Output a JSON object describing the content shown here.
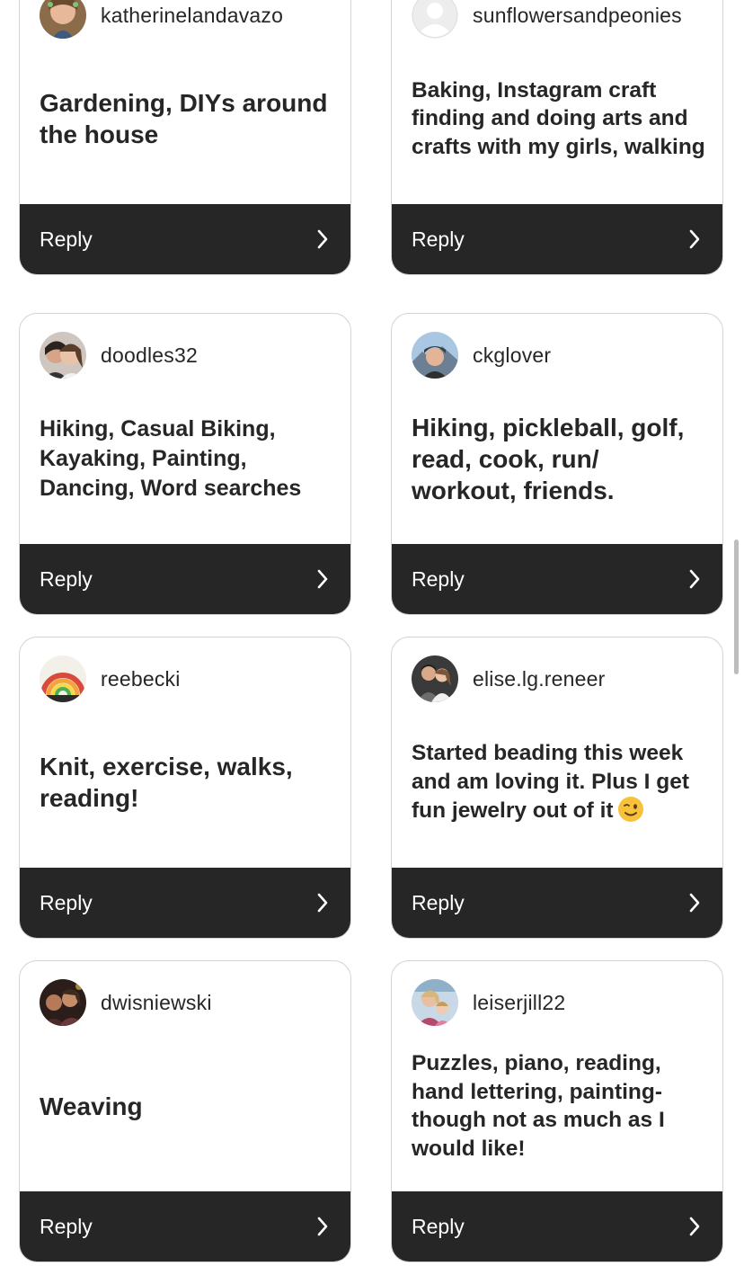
{
  "cards": [
    {
      "username": "katherinelandavazo",
      "text": "Gardening, DIYs around the house",
      "reply": "Reply",
      "avatar": "woman-smiling-avatar"
    },
    {
      "username": "sunflowersandpeonies",
      "text": "Baking, Instagram craft finding and doing arts and crafts with my girls, walking",
      "reply": "Reply",
      "avatar": "default-user-avatar"
    },
    {
      "username": "doodles32",
      "text": "Hiking, Casual Biking, Kayaking, Painting, Dancing, Word searches",
      "reply": "Reply",
      "avatar": "couple-avatar"
    },
    {
      "username": "ckglover",
      "text": "Hiking, pickleball, golf, read, cook, run/ workout, friends.",
      "reply": "Reply",
      "avatar": "woman-mountains-avatar"
    },
    {
      "username": "reebecki",
      "text": "Knit, exercise, walks, reading!",
      "reply": "Reply",
      "avatar": "knit-rainbow-avatar"
    },
    {
      "username": "elise.lg.reneer",
      "text": "Started beading this week and am loving it. Plus I get fun jewelry out of it",
      "reply": "Reply",
      "avatar": "couple-dark-avatar"
    },
    {
      "username": "dwisniewski",
      "text": "Weaving",
      "reply": "Reply",
      "avatar": "group-night-avatar"
    },
    {
      "username": "leiserjill22",
      "text": "Puzzles, piano, reading, hand lettering, painting- though not as much as I would like!",
      "reply": "Reply",
      "avatar": "mother-daughter-avatar"
    }
  ],
  "emoji": "winking-face-emoji",
  "colors": {
    "card_border": "#d4d4d4",
    "reply_bar": "#262626",
    "text": "#262626"
  }
}
